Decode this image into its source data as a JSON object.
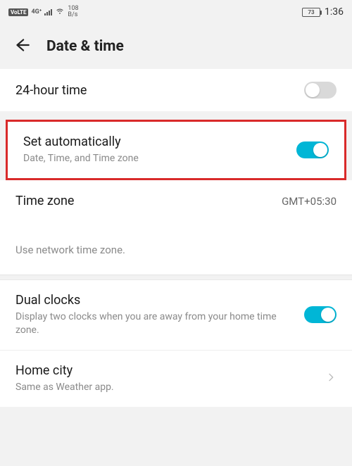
{
  "status": {
    "volte": "VoLTE",
    "network_gen": "4G⁺",
    "speed_value": "108",
    "speed_unit": "B/s",
    "battery_pct": "73",
    "clock": "1:36"
  },
  "header": {
    "title": "Date & time"
  },
  "rows": {
    "hour24": {
      "title": "24-hour time"
    },
    "auto": {
      "title": "Set automatically",
      "sub": "Date, Time, and Time zone"
    },
    "tz": {
      "title": "Time zone",
      "value": "GMT+05:30"
    },
    "tz_helper": "Use network time zone.",
    "dual": {
      "title": "Dual clocks",
      "sub": "Display two clocks when you are away from your home time zone."
    },
    "home": {
      "title": "Home city",
      "sub": "Same as Weather app."
    }
  }
}
